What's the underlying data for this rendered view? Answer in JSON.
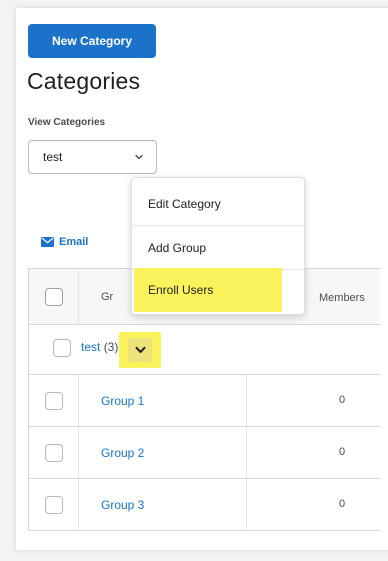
{
  "header": {
    "new_category_label": "New Category",
    "title": "Categories"
  },
  "view_categories": {
    "label": "View Categories",
    "selected": "test"
  },
  "actions": {
    "email_label": "Email"
  },
  "table": {
    "columns": {
      "group": "Gr",
      "members": "Members"
    },
    "category": {
      "name": "test",
      "count": "(3)"
    },
    "rows": [
      {
        "name": "Group 1",
        "members": "0"
      },
      {
        "name": "Group 2",
        "members": "0"
      },
      {
        "name": "Group 3",
        "members": "0"
      }
    ]
  },
  "context_menu": {
    "items": [
      "Edit Category",
      "Add Group",
      "Enroll Users"
    ],
    "highlighted": "Enroll Users"
  },
  "colors": {
    "primary": "#1a73c9",
    "highlight": "#fbf35c"
  }
}
